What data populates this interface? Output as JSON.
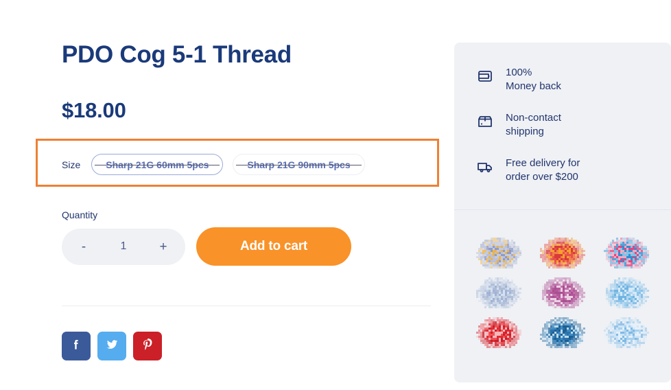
{
  "product": {
    "title": "PDO Cog 5-1 Thread",
    "price": "$18.00"
  },
  "size_selector": {
    "label": "Size",
    "highlighted": true,
    "highlight_color": "#ee8034",
    "options": [
      {
        "label": "Sharp 21G 60mm 5pcs",
        "sold_out": true,
        "selected": true
      },
      {
        "label": "Sharp 21G 90mm 5pcs",
        "sold_out": true,
        "selected": false
      }
    ]
  },
  "quantity": {
    "label": "Quantity",
    "value": "1",
    "decrement_label": "-",
    "increment_label": "+"
  },
  "cart": {
    "add_label": "Add to cart",
    "button_color": "#f99229"
  },
  "social": [
    {
      "name": "facebook",
      "color": "#3b5a9a"
    },
    {
      "name": "twitter",
      "color": "#55acee"
    },
    {
      "name": "pinterest",
      "color": "#cb2027"
    }
  ],
  "side_panel": {
    "background": "#eff1f5",
    "features": [
      {
        "icon": "wallet-icon",
        "line1": "100%",
        "line2": "Money back"
      },
      {
        "icon": "box-icon",
        "line1": "Non-contact",
        "line2": "shipping"
      },
      {
        "icon": "truck-icon",
        "line1": "Free delivery for",
        "line2": "order over $200"
      }
    ],
    "thumbnails": [
      {
        "id": 1,
        "palette": [
          "#b9c0d8",
          "#8e9bc6",
          "#f3b23a",
          "#c5cbdd"
        ]
      },
      {
        "id": 2,
        "palette": [
          "#e8514c",
          "#d93a3a",
          "#f5a22b",
          "#f2804a"
        ]
      },
      {
        "id": 3,
        "palette": [
          "#7fc4e8",
          "#2f8fd0",
          "#e0467e",
          "#f0a9c4"
        ]
      },
      {
        "id": 4,
        "palette": [
          "#aebbd6",
          "#c3cfe2",
          "#9fb3d4",
          "#d5e0ef"
        ]
      },
      {
        "id": 5,
        "palette": [
          "#b4569a",
          "#c270ac",
          "#a94f8f",
          "#e8d2e2"
        ]
      },
      {
        "id": 6,
        "palette": [
          "#8cc3e8",
          "#6fb4e2",
          "#aed5f0",
          "#d6e9f7"
        ]
      },
      {
        "id": 7,
        "palette": [
          "#e02a33",
          "#f05055",
          "#c81f28",
          "#f3b8bb"
        ]
      },
      {
        "id": 8,
        "palette": [
          "#2c72a8",
          "#3e8cc4",
          "#1d5f92",
          "#bcd9ec"
        ]
      },
      {
        "id": 9,
        "palette": [
          "#7fb9e4",
          "#a8d0ee",
          "#cde4f6",
          "#e3f0fa"
        ]
      }
    ]
  },
  "colors": {
    "navy": "#1a3a7a",
    "text_blue": "#22356d",
    "orange": "#f99229",
    "panel_bg": "#eff1f5"
  }
}
